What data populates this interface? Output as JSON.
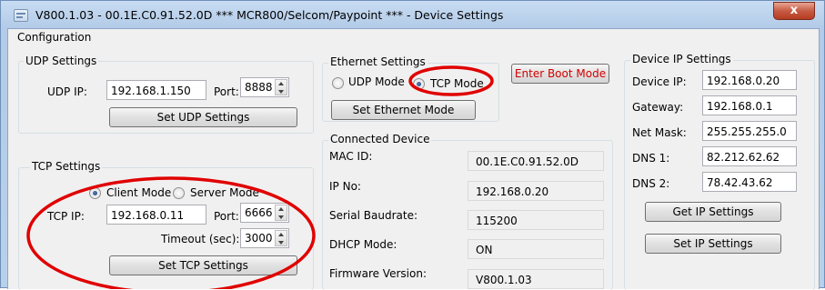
{
  "window": {
    "title": "V800.1.03 - 00.1E.C0.91.52.0D *** MCR800/Selcom/Paypoint *** - Device Settings",
    "close_label": "x"
  },
  "menu": {
    "configuration": "Configuration"
  },
  "udp": {
    "group_label": "UDP Settings",
    "ip_label": "UDP IP:",
    "ip_value": "192.168.1.150",
    "port_label": "Port:",
    "port_value": "8888",
    "set_button": "Set UDP Settings"
  },
  "tcp": {
    "group_label": "TCP Settings",
    "client_mode": "Client Mode",
    "server_mode": "Server Mode",
    "ip_label": "TCP IP:",
    "ip_value": "192.168.0.11",
    "port_label": "Port:",
    "port_value": "6666",
    "timeout_label": "Timeout (sec):",
    "timeout_value": "3000",
    "set_button": "Set TCP Settings"
  },
  "ethernet": {
    "group_label": "Ethernet Settings",
    "udp_mode": "UDP Mode",
    "tcp_mode": "TCP Mode",
    "set_button": "Set Ethernet Mode",
    "boot_button": "Enter Boot Mode"
  },
  "connected": {
    "group_label": "Connected Device",
    "mac_label": "MAC ID:",
    "mac_value": "00.1E.C0.91.52.0D",
    "ip_label": "IP No:",
    "ip_value": "192.168.0.20",
    "baud_label": "Serial Baudrate:",
    "baud_value": "115200",
    "dhcp_label": "DHCP Mode:",
    "dhcp_value": "ON",
    "fw_label": "Firmware Version:",
    "fw_value": "V800.1.03"
  },
  "device_ip": {
    "group_label": "Device IP Settings",
    "device_ip_label": "Device IP:",
    "device_ip_value": "192.168.0.20",
    "gateway_label": "Gateway:",
    "gateway_value": "192.168.0.1",
    "netmask_label": "Net Mask:",
    "netmask_value": "255.255.255.0",
    "dns1_label": "DNS 1:",
    "dns1_value": "82.212.62.62",
    "dns2_label": "DNS 2:",
    "dns2_value": "78.42.43.62",
    "get_button": "Get IP Settings",
    "set_button": "Set IP Settings"
  },
  "colors": {
    "annotation": "#e00000",
    "boot_text": "#d40000",
    "title_bar": "#b9d0ea"
  }
}
